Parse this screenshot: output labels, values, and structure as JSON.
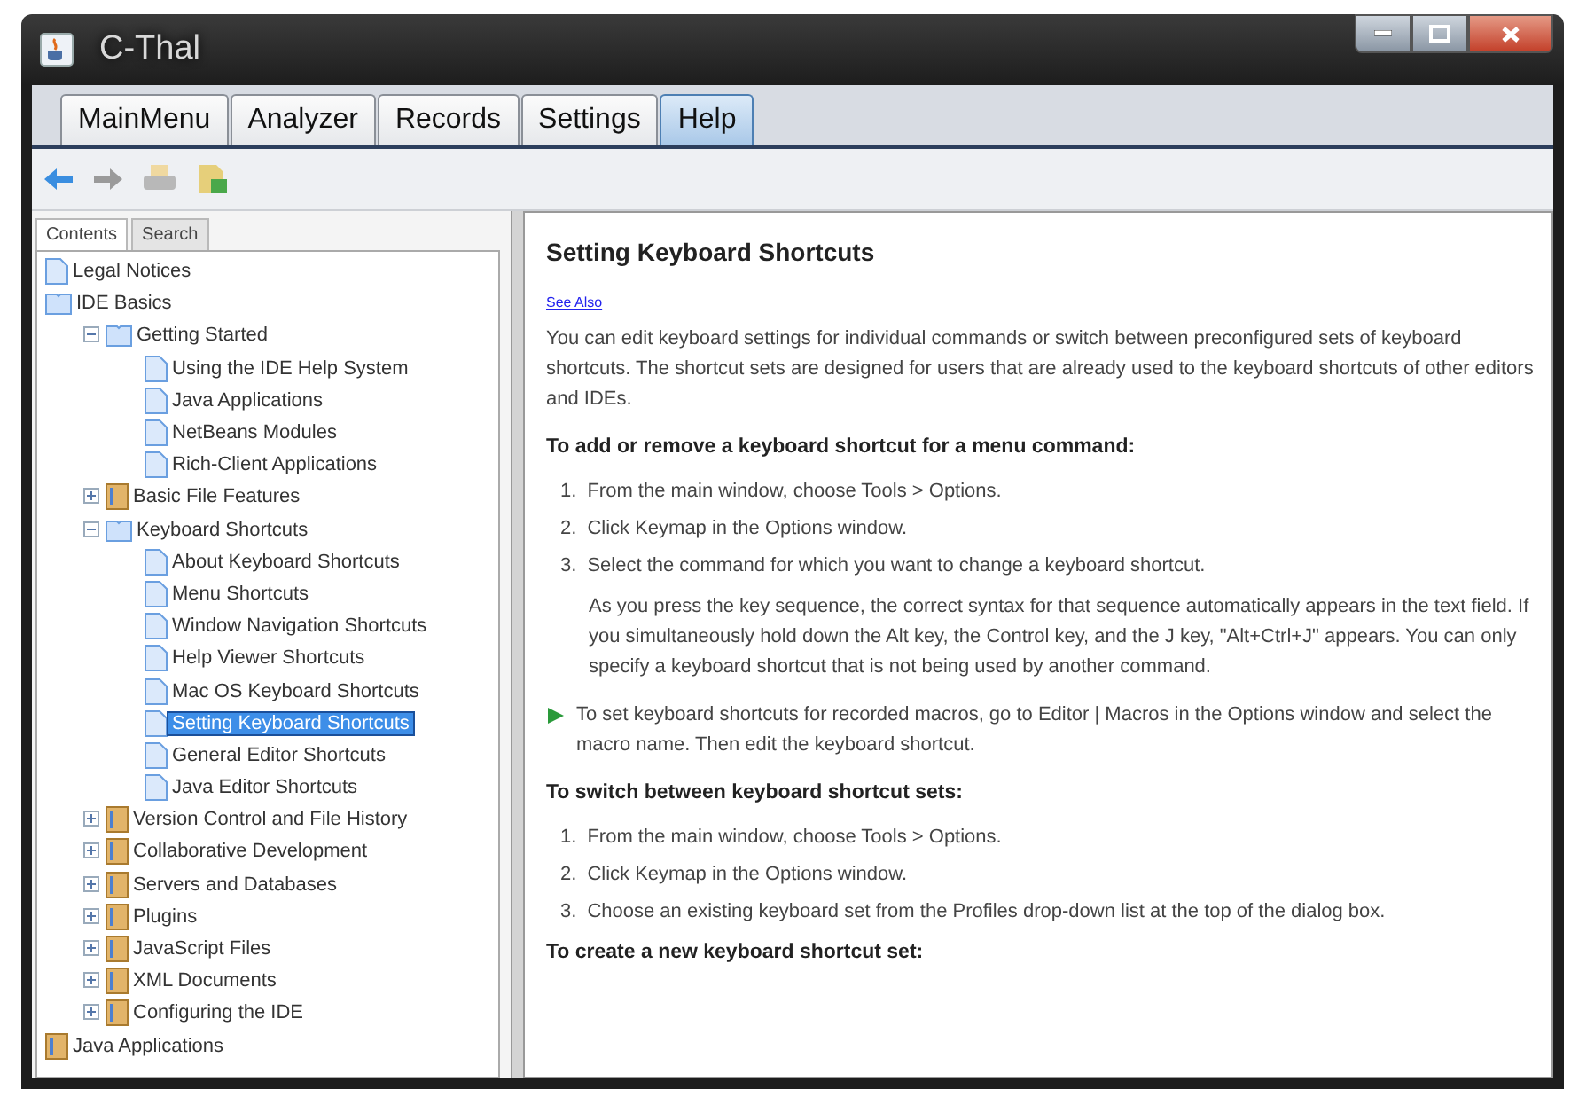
{
  "window": {
    "title": "C-Thal"
  },
  "tabs": [
    {
      "label": "MainMenu",
      "selected": false
    },
    {
      "label": "Analyzer",
      "selected": false
    },
    {
      "label": "Records",
      "selected": false
    },
    {
      "label": "Settings",
      "selected": false
    },
    {
      "label": "Help",
      "selected": true
    }
  ],
  "navigator": {
    "tabs": [
      {
        "label": "Contents",
        "selected": true
      },
      {
        "label": "Search",
        "selected": false
      }
    ],
    "tree": [
      {
        "label": "Legal Notices",
        "kind": "page",
        "selected": false
      },
      {
        "label": "IDE Basics",
        "kind": "book",
        "expanded": true,
        "selected": false,
        "children": [
          {
            "label": "Getting Started",
            "kind": "book",
            "expanded": true,
            "selected": false,
            "children": [
              {
                "label": "Using the IDE Help System",
                "kind": "page",
                "selected": false
              },
              {
                "label": "Java Applications",
                "kind": "page",
                "selected": false
              },
              {
                "label": "NetBeans Modules",
                "kind": "page",
                "selected": false
              },
              {
                "label": "Rich-Client Applications",
                "kind": "page",
                "selected": false
              }
            ]
          },
          {
            "label": "Basic File Features",
            "kind": "book",
            "expanded": false,
            "selected": false
          },
          {
            "label": "Keyboard Shortcuts",
            "kind": "book",
            "expanded": true,
            "selected": false,
            "children": [
              {
                "label": "About Keyboard Shortcuts",
                "kind": "page",
                "selected": false
              },
              {
                "label": "Menu Shortcuts",
                "kind": "page",
                "selected": false
              },
              {
                "label": "Window Navigation Shortcuts",
                "kind": "page",
                "selected": false
              },
              {
                "label": "Help Viewer Shortcuts",
                "kind": "page",
                "selected": false
              },
              {
                "label": "Mac OS Keyboard Shortcuts",
                "kind": "page",
                "selected": false
              },
              {
                "label": "Setting Keyboard Shortcuts",
                "kind": "page",
                "selected": true
              },
              {
                "label": "General Editor Shortcuts",
                "kind": "page",
                "selected": false
              },
              {
                "label": "Java Editor Shortcuts",
                "kind": "page",
                "selected": false
              }
            ]
          },
          {
            "label": "Version Control and File History",
            "kind": "book",
            "expanded": false,
            "selected": false
          },
          {
            "label": "Collaborative Development",
            "kind": "book",
            "expanded": false,
            "selected": false
          },
          {
            "label": "Servers and Databases",
            "kind": "book",
            "expanded": false,
            "selected": false
          },
          {
            "label": "Plugins",
            "kind": "book",
            "expanded": false,
            "selected": false
          },
          {
            "label": "JavaScript Files",
            "kind": "book",
            "expanded": false,
            "selected": false
          },
          {
            "label": "XML Documents",
            "kind": "book",
            "expanded": false,
            "selected": false
          },
          {
            "label": "Configuring the IDE",
            "kind": "book",
            "expanded": false,
            "selected": false
          }
        ]
      },
      {
        "label": "Java Applications",
        "kind": "book",
        "expanded": false,
        "selected": false
      }
    ]
  },
  "article": {
    "title": "Setting Keyboard Shortcuts",
    "link": "See Also",
    "blocks": [
      {
        "kind": "para",
        "text": "You can edit keyboard settings for individual commands or switch between preconfigured sets of keyboard shortcuts. The shortcut sets are designed for users that are already used to the keyboard shortcuts of other editors and IDEs."
      },
      {
        "kind": "heading",
        "text": "To add or remove a keyboard shortcut for a menu command:"
      },
      {
        "kind": "step",
        "number": "1.",
        "text": "From the main window, choose Tools > Options."
      },
      {
        "kind": "step",
        "number": "2.",
        "text": "Click Keymap in the Options window."
      },
      {
        "kind": "step",
        "number": "3.",
        "text": "Select the command for which you want to change a keyboard shortcut."
      },
      {
        "kind": "note",
        "text": "As you press the key sequence, the correct syntax for that sequence automatically appears in the text field. If you simultaneously hold down the Alt key, the Control key, and the J key, \"Alt+Ctrl+J\" appears. You can only specify a keyboard shortcut that is not being used by another command."
      },
      {
        "kind": "tip",
        "text": "To set keyboard shortcuts for recorded macros, go to Editor | Macros in the Options window and select the macro name. Then edit the keyboard shortcut."
      },
      {
        "kind": "heading",
        "text": "To switch between keyboard shortcut sets:"
      },
      {
        "kind": "step",
        "number": "1.",
        "text": "From the main window, choose Tools > Options."
      },
      {
        "kind": "step",
        "number": "2.",
        "text": "Click Keymap in the Options window."
      },
      {
        "kind": "step",
        "number": "3.",
        "text": "Choose an existing keyboard set from the Profiles drop-down list at the top of the dialog box."
      },
      {
        "kind": "heading",
        "text": "To create a new keyboard shortcut set:"
      }
    ]
  }
}
